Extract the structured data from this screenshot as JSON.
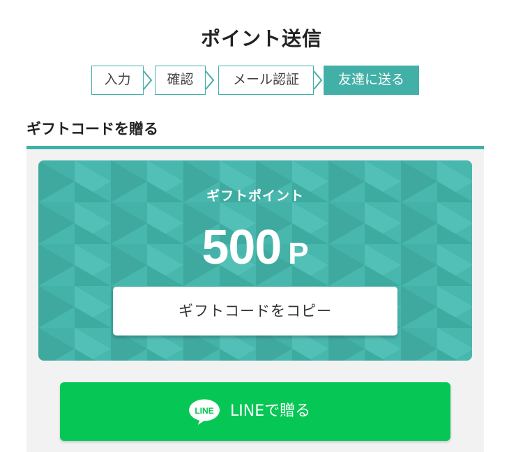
{
  "header": {
    "title": "ポイント送信"
  },
  "steps": [
    {
      "label": "入力",
      "active": false
    },
    {
      "label": "確認",
      "active": false
    },
    {
      "label": "メール認証",
      "active": false
    },
    {
      "label": "友達に送る",
      "active": true
    }
  ],
  "section": {
    "title": "ギフトコードを贈る"
  },
  "gift_card": {
    "label": "ギフトポイント",
    "amount": "500",
    "unit": "P",
    "copy_button_label": "ギフトコードをコピー"
  },
  "line_button": {
    "logo_text": "LINE",
    "label": "LINEで贈る"
  },
  "colors": {
    "accent": "#42b0a7",
    "card": "#48b7ad",
    "line_green": "#06c755",
    "panel_bg": "#f2f2f2"
  },
  "icons": {
    "line_logo": "line-logo-icon",
    "step_arrow": "chevron-right-icon"
  }
}
